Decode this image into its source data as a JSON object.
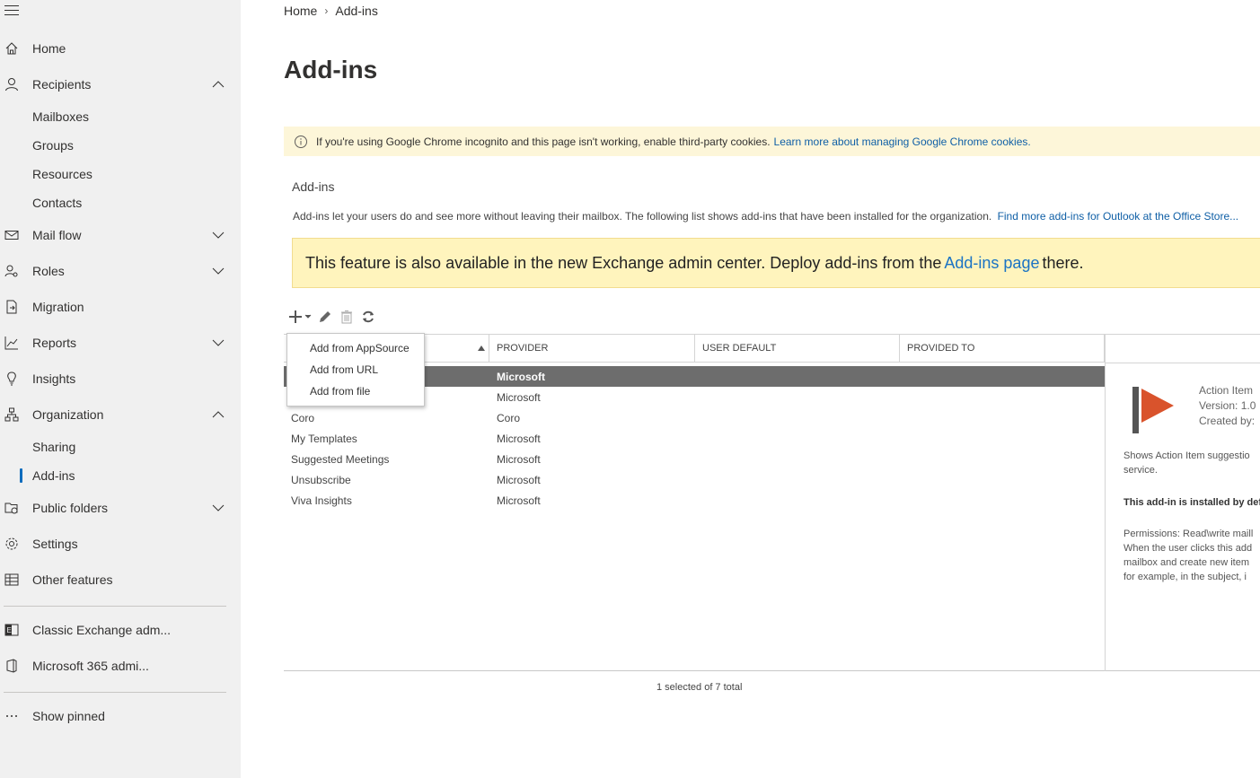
{
  "sidebar": {
    "items": [
      {
        "label": "Home"
      },
      {
        "label": "Recipients"
      },
      {
        "label": "Mailboxes"
      },
      {
        "label": "Groups"
      },
      {
        "label": "Resources"
      },
      {
        "label": "Contacts"
      },
      {
        "label": "Mail flow"
      },
      {
        "label": "Roles"
      },
      {
        "label": "Migration"
      },
      {
        "label": "Reports"
      },
      {
        "label": "Insights"
      },
      {
        "label": "Organization"
      },
      {
        "label": "Sharing"
      },
      {
        "label": "Add-ins"
      },
      {
        "label": "Public folders"
      },
      {
        "label": "Settings"
      },
      {
        "label": "Other features"
      },
      {
        "label": "Classic Exchange adm..."
      },
      {
        "label": "Microsoft 365 admi..."
      },
      {
        "label": "Show pinned"
      }
    ]
  },
  "breadcrumb": {
    "home": "Home",
    "current": "Add-ins"
  },
  "page_title": "Add-ins",
  "info_bar": {
    "text": "If you're using Google Chrome incognito and this page isn't working, enable third-party cookies.",
    "link": "Learn more about managing Google Chrome cookies."
  },
  "section": {
    "title": "Add-ins",
    "description": "Add-ins let your users do and see more without leaving their mailbox. The following list shows add-ins that have been installed for the organization.",
    "description_link": "Find more add-ins for Outlook at the Office Store..."
  },
  "notice": {
    "text": "This feature is also available in the new Exchange admin center. Deploy add-ins from the",
    "link": "Add-ins page",
    "after": "there."
  },
  "grid": {
    "columns": [
      "PROVIDER",
      "USER DEFAULT",
      "PROVIDED TO"
    ],
    "rows": [
      {
        "name": "",
        "provider": "Microsoft"
      },
      {
        "name": "",
        "provider": "Microsoft"
      },
      {
        "name": "Coro",
        "provider": "Coro"
      },
      {
        "name": "My Templates",
        "provider": "Microsoft"
      },
      {
        "name": "Suggested Meetings",
        "provider": "Microsoft"
      },
      {
        "name": "Unsubscribe",
        "provider": "Microsoft"
      },
      {
        "name": "Viva Insights",
        "provider": "Microsoft"
      }
    ],
    "footer": "1 selected of 7 total"
  },
  "detail": {
    "name": "Action Item",
    "version": "Version: 1.0",
    "created_by": "Created by:",
    "desc1": "Shows Action Item suggestio",
    "desc2": "service.",
    "installed": "This add-in is installed by def",
    "perm1": "Permissions: Read\\write maill",
    "perm2": "When the user clicks this add",
    "perm3": "mailbox and create new item",
    "perm4": "for example, in the subject, i",
    "logo_color": "#d9532c"
  },
  "add_menu": {
    "items": [
      "Add from AppSource",
      "Add from URL",
      "Add from file"
    ]
  }
}
